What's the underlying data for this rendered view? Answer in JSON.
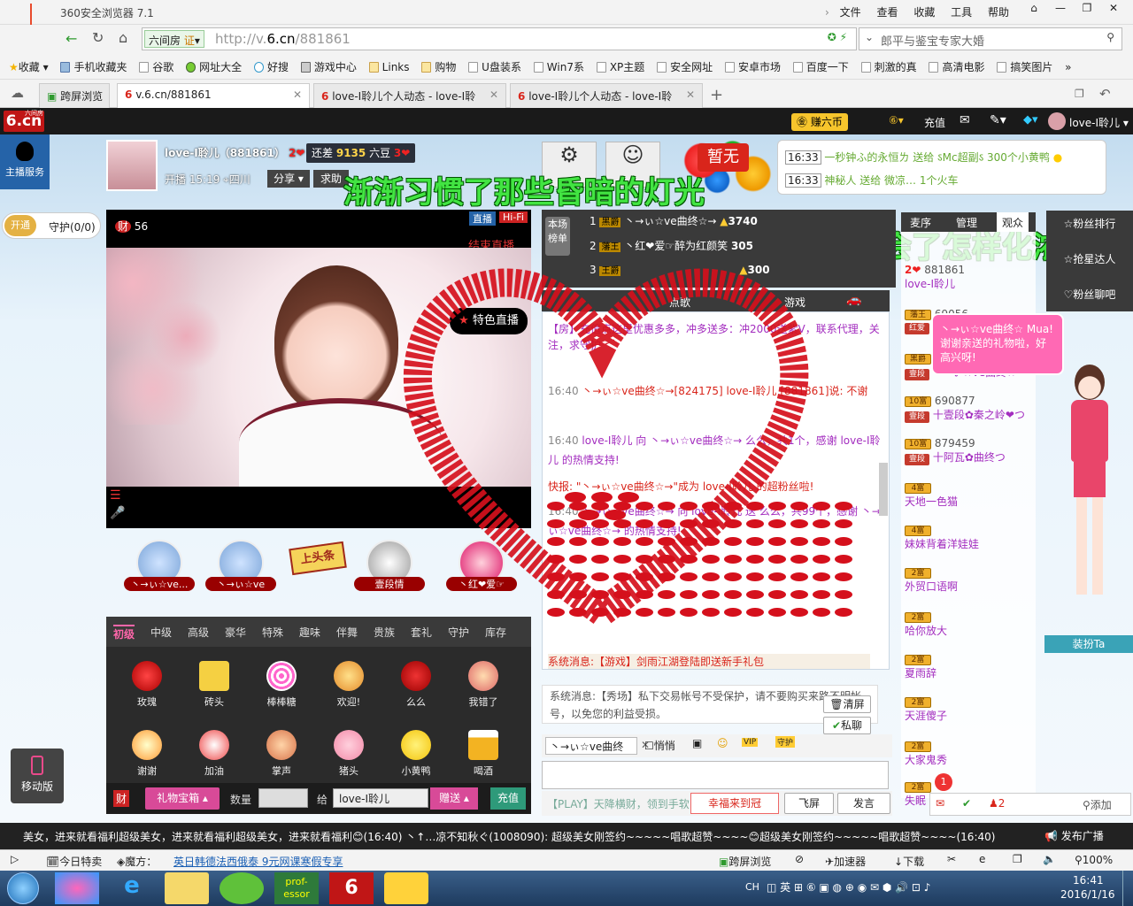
{
  "browser": {
    "title": "360安全浏览器 7.1",
    "menu": [
      "文件",
      "查看",
      "收藏",
      "工具",
      "帮助"
    ],
    "site_label": "六间房",
    "cert_label": "证",
    "url_prefix": "http://v.",
    "url_host": "6.cn",
    "url_path": "/881861",
    "search_text": "郎平与鉴宝专家大婚",
    "favorites": [
      "收藏",
      "手机收藏夹",
      "谷歌",
      "网址大全",
      "好搜",
      "游戏中心",
      "Links",
      "购物",
      "U盘装系",
      "Win7系",
      "XP主题",
      "安全网址",
      "安卓市场",
      "百度一下",
      "刺激的真",
      "高清电影",
      "搞笑图片"
    ],
    "tabs": [
      {
        "label": "跨屏浏览"
      },
      {
        "label": "v.6.cn/881861"
      },
      {
        "label": "love-I聆儿个人动态 - love-I聆"
      },
      {
        "label": "love-I聆儿个人动态 - love-I聆"
      }
    ]
  },
  "site": {
    "logo": "6.cn",
    "logo_small": "六间房",
    "service": "主播服务",
    "top_buttons": [
      "赚六币",
      "充值"
    ],
    "user_name": "love-I聆儿",
    "host_name": "love-I聆儿（881861）",
    "host_level": "2",
    "gap_text": "还差",
    "gap_value": "9135",
    "gap_unit": "六豆",
    "gap_level": "3",
    "start_time": "开播 15:19",
    "location": "四川",
    "share": "分享",
    "request": "求助",
    "lyric1": "渐渐习惯了那些昏暗的灯光",
    "lyric2": "于是你学会了怎样化浓妆",
    "open_label": "开通",
    "guard_label": "守护(0/0)",
    "viewer_count": "56",
    "live_badge": "直播",
    "hifi_badge": "Hi-Fi",
    "end_live": "结束直播",
    "special_live": "特色直播",
    "top_gifters": [
      "丶→ぃ☆ve...",
      "丶→ぃ☆ve",
      "上头条",
      "壹段情",
      "丶红❤爱☞"
    ],
    "gift_tabs": [
      "初级",
      "中级",
      "高级",
      "豪华",
      "特殊",
      "趣味",
      "伴舞",
      "贵族",
      "套礼",
      "守护",
      "库存"
    ],
    "gifts_row1": [
      "玫瑰",
      "砖头",
      "棒棒糖",
      "欢迎!",
      "么么",
      "我错了"
    ],
    "gifts_row2": [
      "谢谢",
      "加油",
      "掌声",
      "猪头",
      "小黄鸭",
      "喝酒"
    ],
    "gift_box": "礼物宝箱",
    "qty_label": "数量",
    "give_label": "给",
    "give_target": "love-I聆儿",
    "give_button": "赠送",
    "recharge_button": "充值",
    "rank_labels": [
      "本场",
      "榜单"
    ],
    "rank": [
      {
        "n": "1",
        "name": "丶→ぃ☆ve曲终☆→",
        "v": "3740"
      },
      {
        "n": "2",
        "name": "丶红❤爱☞醉为红颜笑",
        "v": "305"
      },
      {
        "n": "3",
        "name": "",
        "v": "300"
      }
    ],
    "no_song": "暂无",
    "gift_notices": [
      {
        "time": "16:33",
        "text": "一秒钟ふ的永恒ㄌ 送给 ऽMc超副ऽ 300个小黄鸭"
      },
      {
        "time": "16:33",
        "text": "神秘人 送给 微凉… 1个火车"
      }
    ],
    "chat_tabs": [
      "点歌",
      "游戏"
    ],
    "chat": [
      {
        "time": "",
        "text": "【房】充值点这里优惠多多，冲多送多：冲2000送紫V，联系代理，关注，求守护"
      },
      {
        "time": "16:40",
        "text": "丶→ぃ☆ve曲终☆→[824175] love-I聆儿 [881861]说: 不谢"
      },
      {
        "time": "16:40",
        "text": "love-I聆儿 向 丶→ぃ☆ve曲终☆→ 么么，共1个，感谢 love-I聆儿 的热情支持!"
      },
      {
        "time": "",
        "text": "快报: \"丶→ぃ☆ve曲终☆→\"成为 love-I聆儿 的超粉丝啦!"
      },
      {
        "time": "16:40",
        "text": "丶→ぃ☆ve曲终☆→ 向 love-I聆儿 送 么么，共99个，感谢 丶→ぃ☆ve曲终☆→ 的热情支持!"
      },
      {
        "time": "",
        "text": "系统消息:【游戏】剑雨江湖登陆即送新手礼包"
      }
    ],
    "sys_msg": "系统消息:【秀场】私下交易帐号不受保护，请不要购买来路不明帐号，以免您的利益受损。",
    "clear_btn": "清屏",
    "private_btn": "私聊",
    "chat_target": "丶→ぃ☆ve曲终",
    "whisper": "悄悄",
    "play_text": "【PLAY】天降横财，领到手软",
    "lucky": "幸福来到冠",
    "fly_btn": "飞屏",
    "send_btn": "发言",
    "viewer_tabs": [
      "麦序",
      "管理",
      "观众"
    ],
    "viewers": [
      {
        "id": "881861",
        "name": "love-I聆儿"
      },
      {
        "id": "69056",
        "name": "红爱"
      },
      {
        "id": "",
        "name": "丶→ぃ☆ve曲终☆→"
      },
      {
        "id": "690877",
        "name": "十壹段✿秦之岭❤つ"
      },
      {
        "id": "879459",
        "name": "十阿瓦✿曲终つ"
      },
      {
        "id": "",
        "name": "天地一色猫"
      },
      {
        "id": "",
        "name": "妹妹背着洋娃娃"
      },
      {
        "id": "",
        "name": "外贸口语啊"
      },
      {
        "id": "",
        "name": "哈你放大"
      },
      {
        "id": "",
        "name": "夏雨辞"
      },
      {
        "id": "",
        "name": "天涯傻子"
      },
      {
        "id": "",
        "name": "大家鬼秀"
      },
      {
        "id": "",
        "name": "失眠"
      }
    ],
    "side_buttons": [
      "粉丝排行",
      "抢星达人",
      "粉丝聊吧"
    ],
    "thanks_bubble": "丶→ぃ☆ve曲终☆ Mua!谢谢亲送的礼物啦，好高兴呀!",
    "dress_up": "装扮Ta",
    "mobile": "移动版",
    "footer_count": "2",
    "footer_add": "添加",
    "notice_count": "1",
    "broadcast": "美女，进来就看福利超级美女，进来就看福利超级美女，进来就看福利😊(16:40)    丶↑…凉不知秋ぐ(1008090): 超级美女刚签约~~~~~唱歌超赞~~~~😊超级美女刚签约~~~~~唱歌超赞~~~~(16:40)",
    "broadcast_btn": "发布广播"
  },
  "statusbar": {
    "today": "今日特卖",
    "magic": "魔方：",
    "ad": "英日韩德法西俄泰 9元网课寒假专享",
    "cross": "跨屏浏览",
    "accel": "加速器",
    "download": "下载",
    "zoom": "100%"
  },
  "taskbar": {
    "time": "16:41",
    "date": "2016/1/16",
    "lang": "CH",
    "professor": "prof-essor"
  },
  "colors": {
    "accent": "#d9251b",
    "green": "#2e9a2e",
    "lyric": "#42e442"
  }
}
